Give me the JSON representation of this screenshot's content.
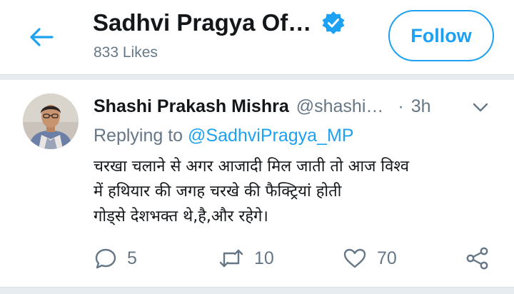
{
  "header": {
    "back_icon": "arrow-left-icon",
    "title": "Sadhvi Pragya Of…",
    "verified_icon": "verified-badge-icon",
    "likes": "833 Likes",
    "follow_label": "Follow"
  },
  "tweet": {
    "avatar_icon": "profile-photo",
    "name": "Shashi Prakash Mishra",
    "handle": "@shashi…",
    "dot": "·",
    "time": "3h",
    "more_icon": "chevron-down-icon",
    "replying_label": "Replying to",
    "replying_to": "@SadhviPragya_MP",
    "body_lines": [
      "चरखा चलाने से अगर आजादी मिल जाती तो आज विश्व",
      "में हथियार की जगह चरखे की फैक्ट्रियां होती",
      "गोड्से देशभक्त थे,है,और रहेगे।"
    ],
    "actions": {
      "reply": {
        "icon": "reply-icon",
        "count": "5"
      },
      "retweet": {
        "icon": "retweet-icon",
        "count": "10"
      },
      "like": {
        "icon": "heart-icon",
        "count": "70"
      },
      "share": {
        "icon": "share-icon"
      }
    }
  },
  "colors": {
    "accent": "#1da1f2",
    "text": "#14171a",
    "muted": "#657786",
    "separator": "#e6ecf0"
  }
}
